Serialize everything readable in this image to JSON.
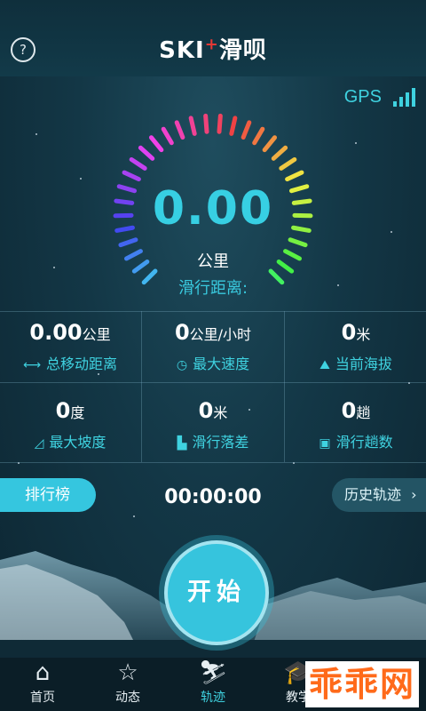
{
  "header": {
    "help_icon": "?",
    "logo": "SKI",
    "logo_plus": "+",
    "logo_cn": "滑呗"
  },
  "gps": {
    "label": "GPS"
  },
  "gauge": {
    "value": "0.00",
    "unit": "公里",
    "label": "滑行距离:"
  },
  "stats": [
    {
      "value": "0.00",
      "unit": "公里",
      "label": "总移动距离",
      "icon": "distance-icon"
    },
    {
      "value": "0",
      "unit": "公里/小时",
      "label": "最大速度",
      "icon": "speed-icon"
    },
    {
      "value": "0",
      "unit": "米",
      "label": "当前海拔",
      "icon": "altitude-icon"
    },
    {
      "value": "0",
      "unit": "度",
      "label": "最大坡度",
      "icon": "slope-icon"
    },
    {
      "value": "0",
      "unit": "米",
      "label": "滑行落差",
      "icon": "drop-icon"
    },
    {
      "value": "0",
      "unit": "趟",
      "label": "滑行趟数",
      "icon": "runs-icon"
    }
  ],
  "buttons": {
    "rank": "排行榜",
    "timer": "00:00:00",
    "history": "历史轨迹",
    "start": "开始"
  },
  "nav": [
    {
      "label": "首页",
      "icon": "home-icon"
    },
    {
      "label": "动态",
      "icon": "star-icon"
    },
    {
      "label": "轨迹",
      "icon": "skier-icon"
    },
    {
      "label": "教学",
      "icon": "graduation-icon"
    }
  ],
  "watermark": "乖乖网",
  "colors": {
    "accent": "#3fd2e0",
    "start": "#36c4dd",
    "watermark": "#ff6a1a"
  }
}
